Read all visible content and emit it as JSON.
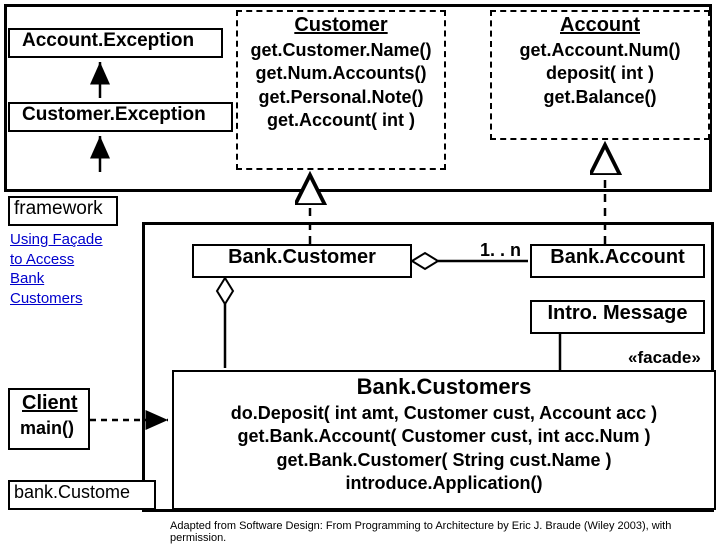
{
  "classes": {
    "accountException": {
      "name": "Account.Exception"
    },
    "customerException": {
      "name": "Customer.Exception"
    },
    "customer": {
      "name": "Customer",
      "methods": [
        "get.Customer.Name()",
        "get.Num.Accounts()",
        "get.Personal.Note()",
        "get.Account( int )"
      ]
    },
    "account": {
      "name": "Account",
      "methods": [
        "get.Account.Num()",
        "deposit( int )",
        "get.Balance()"
      ]
    },
    "framework": {
      "name": "framework"
    },
    "bankCustomer": {
      "name": "Bank.Customer"
    },
    "bankAccount": {
      "name": "Bank.Account"
    },
    "introMessage": {
      "name": "Intro. Message"
    },
    "bankCustomers": {
      "name": "Bank.Customers",
      "methods": [
        "do.Deposit( int amt, Customer cust, Account acc )",
        "get.Bank.Account( Customer cust, int acc.Num )",
        "get.Bank.Customer( String cust.Name )",
        "introduce.Application()"
      ]
    },
    "client": {
      "name": "Client",
      "methods": [
        "main()"
      ]
    },
    "bankCustomerPkg": {
      "name": "bank.Custome"
    }
  },
  "labels": {
    "usingFacade": [
      "Using Façade",
      "to Access",
      "Bank",
      "Customers"
    ],
    "multiplicity": "1. . n",
    "facade": "«facade»"
  },
  "credit": "Adapted from Software Design: From Programming to Architecture by Eric J. Braude (Wiley 2003), with permission."
}
